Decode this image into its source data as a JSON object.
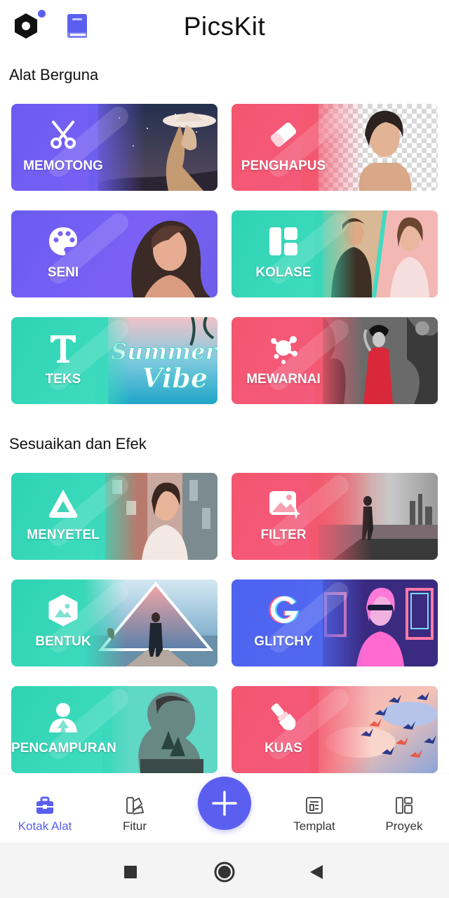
{
  "header": {
    "title": "PicsKit",
    "logo_icon": "hexagon-logo-icon",
    "book_icon": "book-icon",
    "accent": "#5b5ff0"
  },
  "sections": {
    "useful_tools": "Alat Berguna",
    "adjust_effects": "Sesuaikan dan Efek"
  },
  "tools": [
    {
      "label": "MEMOTONG",
      "icon": "scissors-icon",
      "color": "#6a5cf0"
    },
    {
      "label": "PENGHAPUS",
      "icon": "eraser-icon",
      "color": "#f4566f"
    },
    {
      "label": "SENI",
      "icon": "palette-icon",
      "color": "#6a5cf0"
    },
    {
      "label": "KOLASE",
      "icon": "collage-icon",
      "color": "#2fd3b3"
    },
    {
      "label": "TEKS",
      "icon": "text-icon",
      "color": "#2fd3b3"
    },
    {
      "label": "MEWARNAI",
      "icon": "splash-icon",
      "color": "#f4566f"
    }
  ],
  "tool_image_text": {
    "summer": "Summer",
    "vibe": "Vibe"
  },
  "effects": [
    {
      "label": "MENYETEL",
      "icon": "adjust-triangle-icon",
      "color": "#2fd3b3"
    },
    {
      "label": "FILTER",
      "icon": "image-filter-icon",
      "color": "#f4566f"
    },
    {
      "label": "BENTUK",
      "icon": "shape-hexagon-icon",
      "color": "#2fd3b3"
    },
    {
      "label": "GLITCHY",
      "icon": "glitch-g-icon",
      "color": "#4b63f0"
    },
    {
      "label": "PENCAMPURAN",
      "icon": "blend-person-icon",
      "color": "#2fd3b3"
    },
    {
      "label": "KUAS",
      "icon": "brush-icon",
      "color": "#f4566f"
    }
  ],
  "bottom_nav": {
    "items": [
      {
        "label": "Kotak Alat",
        "icon": "toolbox-icon",
        "active": true
      },
      {
        "label": "Fitur",
        "icon": "swatch-icon",
        "active": false
      },
      {
        "label": "Templat",
        "icon": "template-icon",
        "active": false
      },
      {
        "label": "Proyek",
        "icon": "project-icon",
        "active": false
      }
    ],
    "fab_icon": "plus-icon"
  },
  "system_nav": [
    "square-icon",
    "circle-icon",
    "back-triangle-icon"
  ]
}
